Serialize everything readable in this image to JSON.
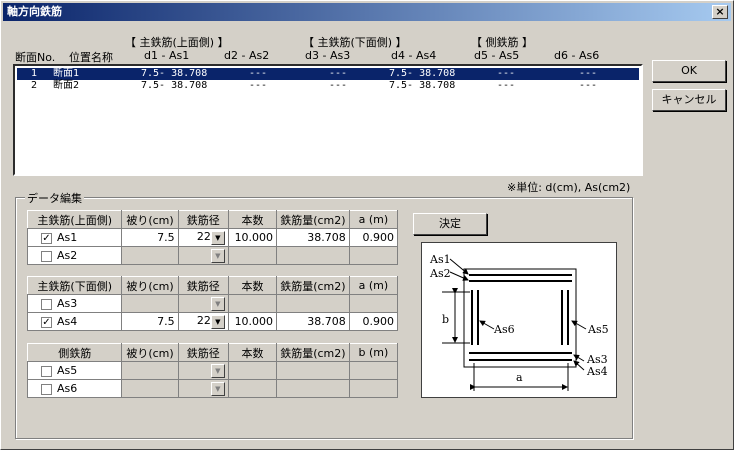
{
  "window": {
    "title": "軸方向鉄筋",
    "close": "×"
  },
  "header": {
    "no": "断面No.",
    "name": "位置名称",
    "group_top": "【 主鉄筋(上面側) 】",
    "group_bottom": "【 主鉄筋(下面側) 】",
    "group_side": "【 側鉄筋 】",
    "col1": "d1 - As1",
    "col2": "d2 - As2",
    "col3": "d3 - As3",
    "col4": "d4 - As4",
    "col5": "d5 - As5",
    "col6": "d6 - As6"
  },
  "list": [
    {
      "no": "1",
      "name": "断面1",
      "c1": "7.5- 38.708",
      "c2": "---",
      "c3": "---",
      "c4": "7.5- 38.708",
      "c5": "---",
      "c6": "---"
    },
    {
      "no": "2",
      "name": "断面2",
      "c1": "7.5- 38.708",
      "c2": "---",
      "c3": "---",
      "c4": "7.5- 38.708",
      "c5": "---",
      "c6": "---"
    }
  ],
  "buttons": {
    "ok": "OK",
    "cancel": "キャンセル",
    "decide": "決定"
  },
  "unit_note": "※単位: d(cm), As(cm2)",
  "edit_group": "データ編集",
  "table_top": {
    "h0": "主鉄筋(上面側)",
    "h1": "被り(cm)",
    "h2": "鉄筋径",
    "h3": "本数",
    "h4": "鉄筋量(cm2)",
    "h5": "a (m)",
    "r1": {
      "checked": true,
      "label": "As1",
      "cover": "7.5",
      "dia": "22",
      "count": "10.000",
      "area": "38.708",
      "a": "0.900"
    },
    "r2": {
      "checked": false,
      "label": "As2"
    }
  },
  "table_bottom": {
    "h0": "主鉄筋(下面側)",
    "h1": "被り(cm)",
    "h2": "鉄筋径",
    "h3": "本数",
    "h4": "鉄筋量(cm2)",
    "h5": "a (m)",
    "r1": {
      "checked": false,
      "label": "As3"
    },
    "r2": {
      "checked": true,
      "label": "As4",
      "cover": "7.5",
      "dia": "22",
      "count": "10.000",
      "area": "38.708",
      "a": "0.900"
    }
  },
  "table_side": {
    "h0": "側鉄筋",
    "h1": "被り(cm)",
    "h2": "鉄筋径",
    "h3": "本数",
    "h4": "鉄筋量(cm2)",
    "h5": "b (m)",
    "r1": {
      "checked": false,
      "label": "As5"
    },
    "r2": {
      "checked": false,
      "label": "As6"
    }
  },
  "diagram": {
    "as1": "As1",
    "as2": "As2",
    "as3": "As3",
    "as4": "As4",
    "as5": "As5",
    "as6": "As6",
    "a": "a",
    "b": "b"
  },
  "icons": {
    "check": "✓",
    "dropdown": "▼"
  }
}
